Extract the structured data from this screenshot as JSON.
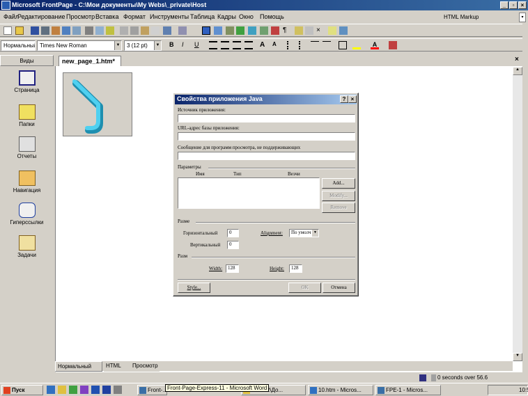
{
  "window": {
    "title": "Microsoft FrontPage - C:\\Мои документы\\My Webs\\_private\\Host"
  },
  "menubar": {
    "items": [
      "Файл",
      "Редактирование",
      "Просмотр",
      "Вставка",
      "Формат",
      "Инструменты",
      "Таблица",
      "Кадры",
      "Окно",
      "Помощь"
    ],
    "right_label": "HTML Markup"
  },
  "format_toolbar": {
    "style": "Нормальный",
    "font": "Times New Roman",
    "size": "3 (12 pt)"
  },
  "views": {
    "header": "Виды",
    "items": [
      {
        "label": "Страница",
        "icon": "page-view-icon"
      },
      {
        "label": "Папки",
        "icon": "folder-icon"
      },
      {
        "label": "Отчеты",
        "icon": "reports-icon"
      },
      {
        "label": "Навигация",
        "icon": "navigation-icon"
      },
      {
        "label": "Гиперссылки",
        "icon": "hyperlinks-icon"
      },
      {
        "label": "Задачи",
        "icon": "tasks-icon"
      }
    ]
  },
  "editor": {
    "tab": "new_page_1.htm*",
    "view_tabs": [
      "Нормальный",
      "HTML",
      "Просмотр"
    ]
  },
  "dialog": {
    "title": "Свойства приложения Java",
    "source_label": "Источник приложения:",
    "source_value": "",
    "base_url_label": "URL-адрес базы приложения:",
    "base_url_value": "",
    "message_label": "Сообщение для программ просмотра, не поддерживающих",
    "message_value": "",
    "params_label": "Параметры",
    "params_columns": [
      "Имя",
      "Тип",
      "Везчи"
    ],
    "add_button": "Add...",
    "modify_button": "Modify...",
    "remove_button": "Remove",
    "layout_label": "Разме",
    "horizontal_label": "Горизонтальный",
    "horizontal_value": "0",
    "vertical_label": "Вертикальный",
    "vertical_value": "0",
    "alignment_label": "Alignment:",
    "alignment_value": "По умолч",
    "size_label": "Разм",
    "width_label": "Width:",
    "width_value": "128",
    "height_label": "Height:",
    "height_value": "128",
    "style_button": "Style...",
    "ok_button": "OK",
    "cancel_button": "Отмена"
  },
  "status": {
    "text": "0 seconds over 56.6"
  },
  "taskbar": {
    "start": "Пуск",
    "tooltip": "Front-Page-Express-11 - Microsoft Word",
    "tasks": [
      "Front-...",
      "\\DISTR\\До...",
      "10.htm - Micros...",
      "FPE-1 - Micros..."
    ],
    "clock": "10:5"
  },
  "colors": {
    "titlebar": "#0a246a",
    "face": "#d4d0c8",
    "applet": "#26a5c8"
  }
}
